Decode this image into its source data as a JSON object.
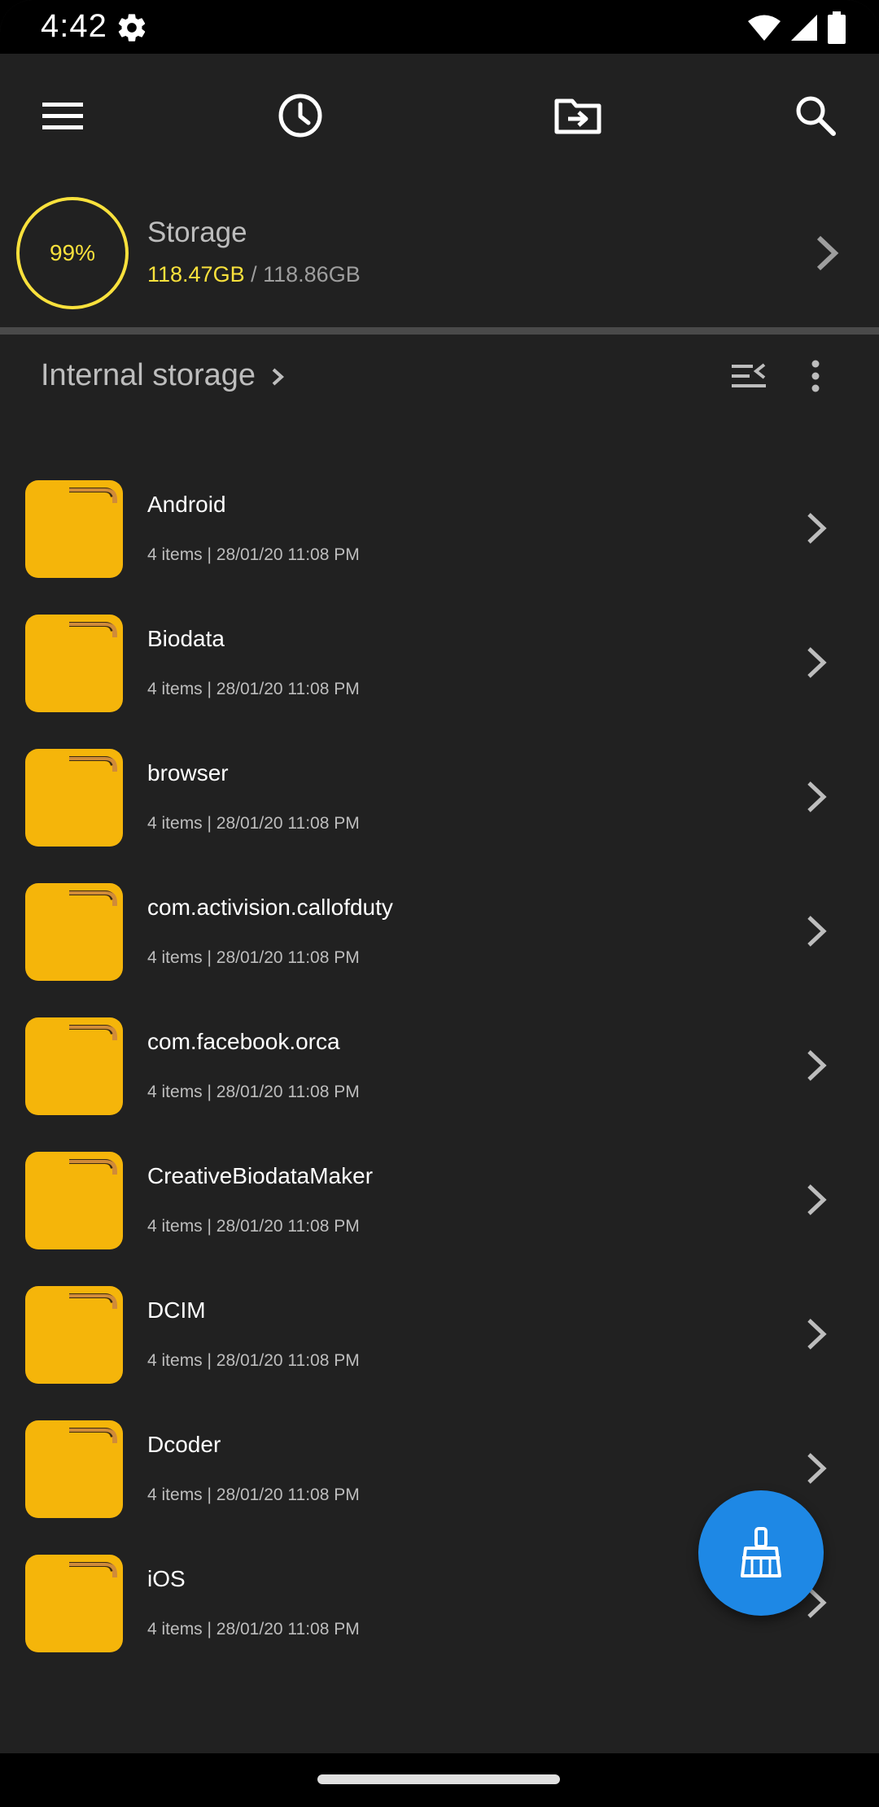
{
  "status_bar": {
    "time": "4:42",
    "icons": [
      "settings-gear-icon",
      "wifi-icon",
      "signal-icon",
      "battery-icon"
    ]
  },
  "toolbar": {
    "icons": [
      "menu-icon",
      "recent-history-icon",
      "move-to-folder-icon",
      "search-icon"
    ]
  },
  "storage": {
    "percent": "99%",
    "title": "Storage",
    "used": "118.47GB",
    "separator": " / ",
    "total": "118.86GB",
    "ring_color": "#f9e13c"
  },
  "path_bar": {
    "label": "Internal storage",
    "icons": [
      "collapse-list-icon",
      "more-vert-icon"
    ]
  },
  "files": [
    {
      "name": "Android",
      "meta": "4 items | 28/01/20 11:08 PM"
    },
    {
      "name": "Biodata",
      "meta": "4 items | 28/01/20 11:08 PM"
    },
    {
      "name": "browser",
      "meta": "4 items | 28/01/20 11:08 PM"
    },
    {
      "name": "com.activision.callofduty",
      "meta": "4 items | 28/01/20 11:08 PM"
    },
    {
      "name": "com.facebook.orca",
      "meta": "4 items | 28/01/20 11:08 PM"
    },
    {
      "name": "CreativeBiodataMaker",
      "meta": "4 items | 28/01/20 11:08 PM"
    },
    {
      "name": "DCIM",
      "meta": "4 items | 28/01/20 11:08 PM"
    },
    {
      "name": "Dcoder",
      "meta": "4 items | 28/01/20 11:08 PM"
    },
    {
      "name": "iOS",
      "meta": "4 items | 28/01/20 11:08 PM"
    }
  ],
  "fab": {
    "icon": "broom-clean-icon"
  },
  "colors": {
    "background": "#212121",
    "folder": "#f5b50a",
    "folder_tab": "#d08b39",
    "accent_yellow": "#f9e13c",
    "fab": "#1e88e5"
  }
}
